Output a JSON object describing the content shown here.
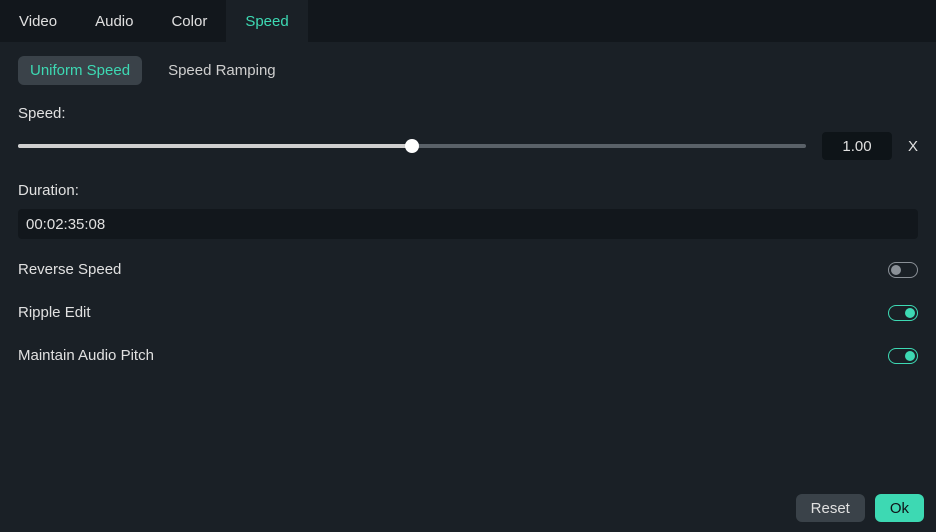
{
  "tabs": {
    "video": "Video",
    "audio": "Audio",
    "color": "Color",
    "speed": "Speed"
  },
  "subtabs": {
    "uniform": "Uniform Speed",
    "ramping": "Speed Ramping"
  },
  "labels": {
    "speed": "Speed:",
    "duration": "Duration:",
    "reverse_speed": "Reverse Speed",
    "ripple_edit": "Ripple Edit",
    "maintain_pitch": "Maintain Audio Pitch"
  },
  "values": {
    "speed": "1.00",
    "speed_unit": "X",
    "duration": "00:02:35:08"
  },
  "buttons": {
    "reset": "Reset",
    "ok": "Ok"
  }
}
